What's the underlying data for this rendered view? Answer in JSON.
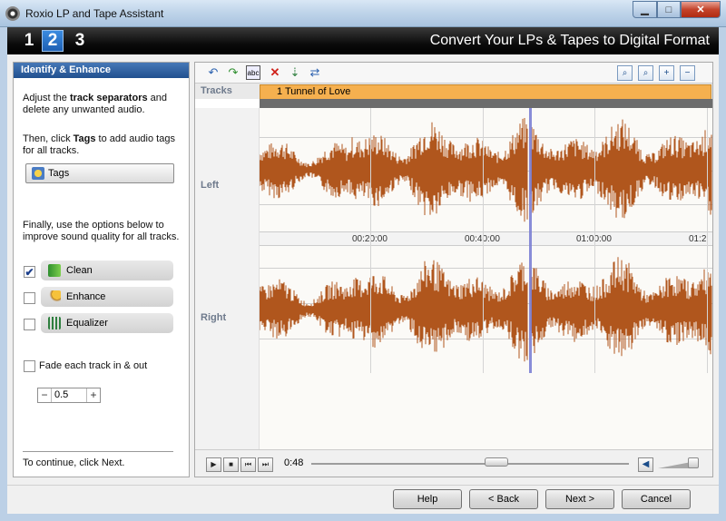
{
  "window": {
    "title": "Roxio LP and Tape Assistant"
  },
  "steps": [
    "1",
    "2",
    "3"
  ],
  "banner": {
    "title": "Convert Your LPs & Tapes to Digital Format"
  },
  "left_panel": {
    "header": "Identify & Enhance",
    "instr1_a": "Adjust the ",
    "instr1_b": "track separators",
    "instr1_c": " and delete any unwanted audio.",
    "instr2_a": "Then, click ",
    "instr2_b": "Tags",
    "instr2_c": " to add audio tags for all tracks.",
    "tags_button": "Tags",
    "instr3": "Finally, use the options below to improve sound quality for all tracks.",
    "options": [
      {
        "label": "Clean",
        "checked": true,
        "check_glyph": "✔"
      },
      {
        "label": "Enhance",
        "checked": false,
        "check_glyph": ""
      },
      {
        "label": "Equalizer",
        "checked": false,
        "check_glyph": ""
      }
    ],
    "fade_label": "Fade each track in & out",
    "fade_value": "0.5",
    "footer": "To continue, click Next."
  },
  "editor": {
    "tracks_label": "Tracks",
    "track_name": "1 Tunnel of Love",
    "channels": [
      "Left",
      "Right"
    ],
    "ruler_labels": [
      "00:20:00",
      "00:40:00",
      "01:00:00",
      "01:2"
    ],
    "current_time": "0:48",
    "position_fraction": 0.62,
    "volume_fraction": 0.85,
    "waveform_color": "#b0561d"
  },
  "buttons": {
    "help": "Help",
    "back": "< Back",
    "next": "Next >",
    "cancel": "Cancel"
  }
}
